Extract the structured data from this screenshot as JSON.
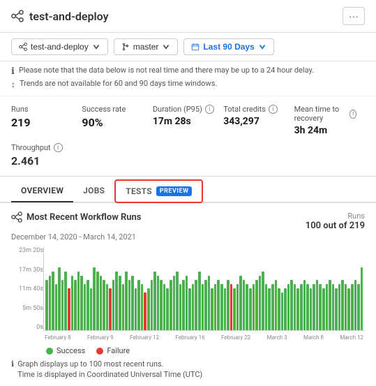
{
  "header": {
    "title": "test-and-deploy",
    "more_label": "···"
  },
  "toolbar": {
    "project_label": "test-and-deploy",
    "branch_label": "master",
    "date_range_label": "Last 90 Days"
  },
  "notices": [
    "Please note that the data below is not real time and there may be up to a 24 hour delay.",
    "Trends are not available for 60 and 90 days time windows."
  ],
  "stats": {
    "runs_label": "Runs",
    "runs_value": "219",
    "success_rate_label": "Success rate",
    "success_rate_value": "90%",
    "duration_label": "Duration (P95)",
    "duration_value": "17m 28s",
    "total_credits_label": "Total credits",
    "total_credits_value": "343,297",
    "mean_time_label": "Mean time to recovery",
    "mean_time_value": "3h 24m",
    "throughput_label": "Throughput",
    "throughput_value": "2.461"
  },
  "tabs": [
    {
      "id": "overview",
      "label": "OVERVIEW",
      "active": false
    },
    {
      "id": "jobs",
      "label": "JOBS",
      "active": false
    },
    {
      "id": "tests",
      "label": "TESTS",
      "active": false,
      "badge": "PREVIEW"
    }
  ],
  "chart": {
    "title": "Most Recent Workflow Runs",
    "date_range": "December 14, 2020 - March 14, 2021",
    "runs_label": "Runs",
    "runs_value": "100 out of 219",
    "y_labels": [
      "23m 20s",
      "17m 30s",
      "11m 40s",
      "5m 50s",
      "0s"
    ],
    "x_labels": [
      "February 8",
      "February 9",
      "February 12",
      "February 16",
      "February 22",
      "March 3",
      "March 8",
      "March 12"
    ],
    "legend": {
      "success_label": "Success",
      "failure_label": "Failure"
    },
    "footer_notes": [
      "Graph displays up to 100 most recent runs.",
      "Time is displayed in Coordinated Universal Time (UTC)"
    ]
  }
}
